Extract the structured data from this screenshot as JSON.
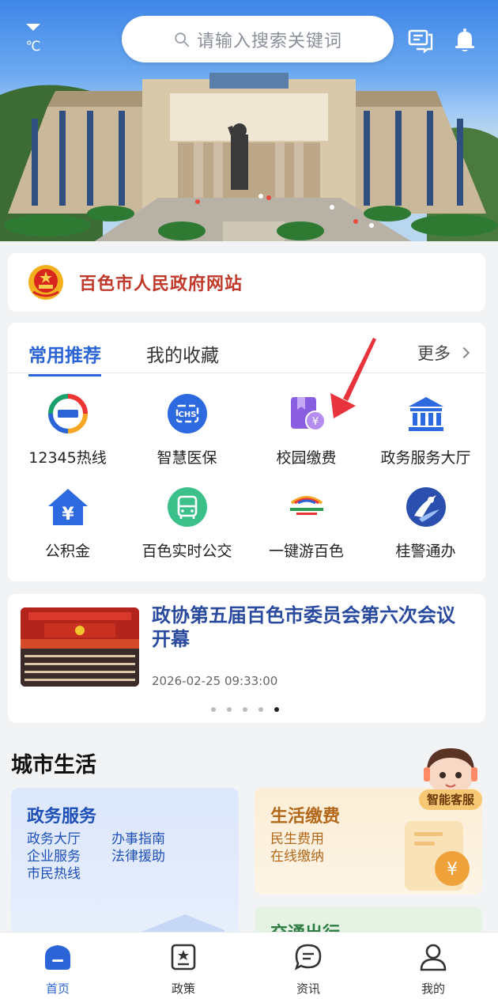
{
  "header": {
    "weather_unit": "℃",
    "search_placeholder": "请输入搜索关键词"
  },
  "gov_site": {
    "name": "百色市人民政府网站"
  },
  "services": {
    "tabs": [
      "常用推荐",
      "我的收藏"
    ],
    "more": "更多",
    "items": [
      {
        "label": "12345热线",
        "icon": "hotline-12345-icon"
      },
      {
        "label": "智慧医保",
        "icon": "chs-insurance-icon"
      },
      {
        "label": "校园缴费",
        "icon": "campus-payment-icon"
      },
      {
        "label": "政务服务大厅",
        "icon": "government-hall-icon"
      },
      {
        "label": "公积金",
        "icon": "housing-fund-icon"
      },
      {
        "label": "百色实时公交",
        "icon": "bus-icon"
      },
      {
        "label": "一键游百色",
        "icon": "tourism-icon"
      },
      {
        "label": "桂警通办",
        "icon": "police-service-icon"
      }
    ]
  },
  "news": {
    "title": "政协第五届百色市委员会第六次会议开幕",
    "date": "2026-02-25 09:33:00",
    "dots": 5,
    "active_dot": 4
  },
  "city_life": {
    "title": "城市生活",
    "gov_service": {
      "title": "政务服务",
      "links": [
        [
          "政务大厅",
          "办事指南"
        ],
        [
          "企业服务",
          "法律援助"
        ],
        [
          "市民热线"
        ]
      ]
    },
    "payment": {
      "title": "生活缴费",
      "links": [
        "民生费用",
        "在线缴纳"
      ]
    },
    "traffic": {
      "title": "交通出行"
    },
    "assistant": "智能客服"
  },
  "bottom_nav": [
    {
      "label": "首页",
      "active": true
    },
    {
      "label": "政策",
      "active": false
    },
    {
      "label": "资讯",
      "active": false
    },
    {
      "label": "我的",
      "active": false
    }
  ],
  "colors": {
    "accent": "#2a64d6",
    "gov_red": "#c0392b",
    "arrow": "#e8323c"
  }
}
